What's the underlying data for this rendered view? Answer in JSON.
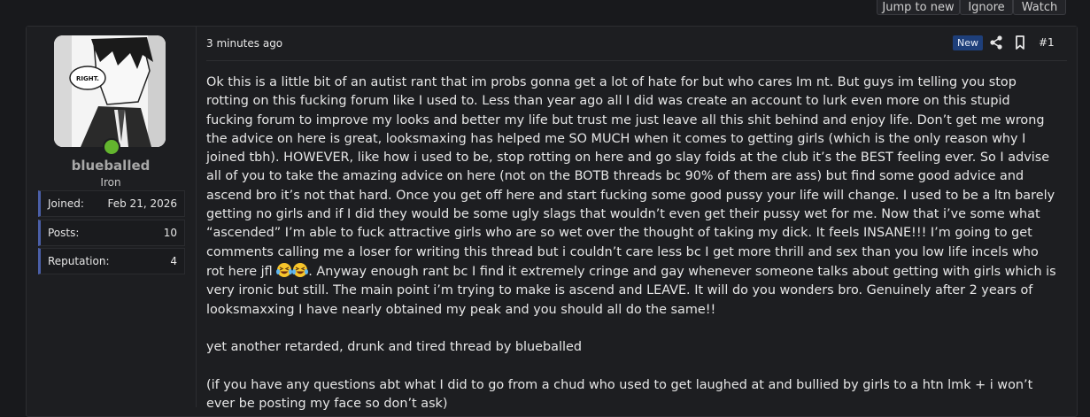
{
  "toolbar": {
    "jump_label": "Jump to new",
    "ignore_label": "Ignore",
    "watch_label": "Watch"
  },
  "user": {
    "name": "blueballed",
    "title": "Iron",
    "online": true,
    "stats": [
      {
        "key": "Joined:",
        "value": "Feb 21, 2026"
      },
      {
        "key": "Posts:",
        "value": "10"
      },
      {
        "key": "Reputation:",
        "value": "4"
      }
    ],
    "avatar_speech": "RIGHT."
  },
  "post": {
    "timestamp": "3 minutes ago",
    "badge": "New",
    "number": "#1",
    "paragraphs": {
      "p1a": "Ok this is a little bit of an autist rant that im probs gonna get a lot of hate for but who cares Im nt. But guys im telling you stop rotting on this fucking forum like I used to. Less than year ago all I did was create an account to lurk even more on this stupid fucking forum to improve my looks and better my life but trust me just leave all this shit behind and enjoy life. Don’t get me wrong the advice on here is great, looksmaxing has helped me SO MUCH when it comes to getting girls (which is the only reason why I joined tbh). HOWEVER, like how i used to be, stop rotting on here and go slay foids at the club it’s the BEST feeling ever. So I advise all of you to take the amazing advice on here (not on the BOTB threads bc 90% of them are ass) but find some good advice and ascend bro it’s not that hard. Once you get off here and start fucking some good pussy your life will change. I used to be a ltn barely getting no girls and if I did they would be some ugly slags that wouldn’t even get their pussy wet for me. Now that i’ve some what “ascended” I’m able to fuck attractive girls who are so wet over the thought of taking my dick. It feels INSANE!!! I’m going to get comments calling me a loser for writing this thread but i couldn’t care less bc I get more thrill and sex than you low life incels who rot here jfl",
      "p1b": ". Anyway enough rant bc I find it extremely cringe and gay whenever someone talks about getting with girls which is very ironic but still. The main point i’m trying to make is ascend and LEAVE. It will do you wonders bro. Genuinely after 2 years of looksmaxxing I have nearly obtained my peak and you should all do the same!!",
      "p2": "yet another retarded, drunk and tired thread by blueballed",
      "p3": "(if you have any questions abt what I did to go from a chud who used to get laughed at and bullied by girls to a htn lmk + i won’t ever be posting my face so don’t ask)"
    },
    "emoji": "laughing-crying-emoji"
  },
  "colors": {
    "background": "#18191c",
    "panel": "#1d1e21",
    "accent": "#4b5fa8",
    "online": "#63b52e",
    "badge": "#1e3f7a"
  }
}
